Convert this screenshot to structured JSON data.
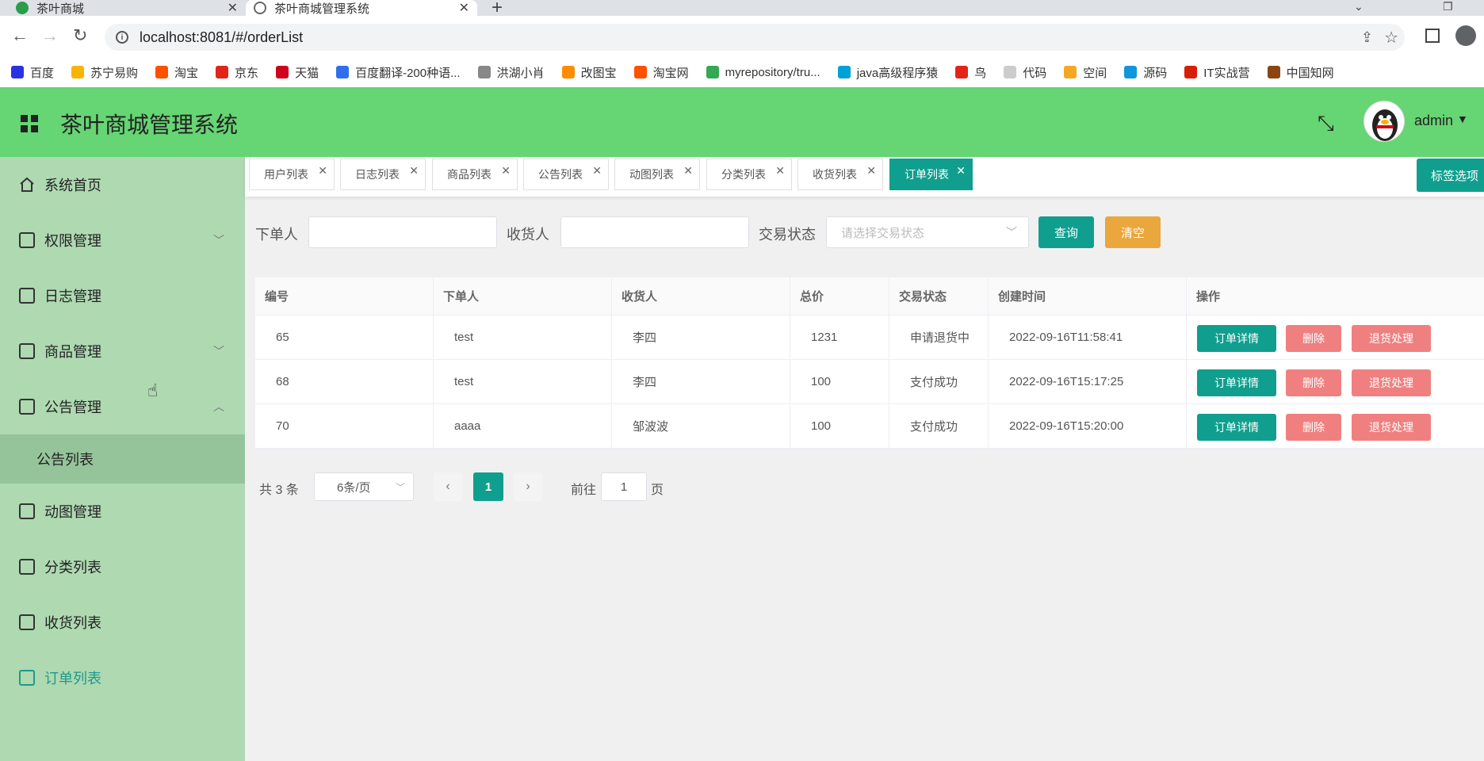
{
  "browser": {
    "tabs": [
      {
        "title": "茶叶商城",
        "favicon_color": "#2a9d4a"
      },
      {
        "title": "茶叶商城管理系统",
        "favicon_color": "#888888"
      }
    ],
    "url": "localhost:8081/#/orderList",
    "bookmarks": [
      {
        "label": "百度",
        "color": "#2932e1"
      },
      {
        "label": "苏宁易购",
        "color": "#f7b500"
      },
      {
        "label": "淘宝",
        "color": "#ff5000"
      },
      {
        "label": "京东",
        "color": "#e1251b"
      },
      {
        "label": "天猫",
        "color": "#d0021b"
      },
      {
        "label": "百度翻译-200种语...",
        "color": "#2f6fec"
      },
      {
        "label": "洪湖小肖",
        "color": "#888888"
      },
      {
        "label": "改图宝",
        "color": "#ff8c00"
      },
      {
        "label": "淘宝网",
        "color": "#ff5000"
      },
      {
        "label": "myrepository/tru...",
        "color": "#34a853"
      },
      {
        "label": "java高级程序猿",
        "color": "#00a1d6"
      },
      {
        "label": "鸟",
        "color": "#e2231a"
      },
      {
        "label": "代码",
        "color": "#cccccc"
      },
      {
        "label": "空间",
        "color": "#f5a623"
      },
      {
        "label": "源码",
        "color": "#1296db"
      },
      {
        "label": "IT实战营",
        "color": "#d81e06"
      },
      {
        "label": "中国知网",
        "color": "#8b4513"
      }
    ]
  },
  "header": {
    "title": "茶叶商城管理系统",
    "username": "admin",
    "bg_color": "#66d573"
  },
  "sidebar": {
    "items": [
      {
        "label": "系统首页",
        "icon": "home-icon",
        "chevron": ""
      },
      {
        "label": "权限管理",
        "icon": "doc-icon",
        "chevron": "﹀"
      },
      {
        "label": "日志管理",
        "icon": "calendar-icon",
        "chevron": ""
      },
      {
        "label": "商品管理",
        "icon": "doc-icon",
        "chevron": "﹀"
      },
      {
        "label": "公告管理",
        "icon": "doc-icon",
        "chevron": "︿"
      },
      {
        "label": "动图管理",
        "icon": "doc-icon",
        "chevron": ""
      },
      {
        "label": "分类列表",
        "icon": "doc-icon",
        "chevron": ""
      },
      {
        "label": "收货列表",
        "icon": "calendar-icon",
        "chevron": ""
      },
      {
        "label": "订单列表",
        "icon": "calendar-icon",
        "chevron": ""
      }
    ],
    "submenu_label": "公告列表",
    "active_item": "订单列表"
  },
  "tags": {
    "items": [
      "用户列表",
      "日志列表",
      "商品列表",
      "公告列表",
      "动图列表",
      "分类列表",
      "收货列表",
      "订单列表"
    ],
    "active": "订单列表",
    "options_label": "标签选项"
  },
  "search": {
    "orderer_label": "下单人",
    "orderer_value": "",
    "receiver_label": "收货人",
    "receiver_value": "",
    "status_label": "交易状态",
    "status_placeholder": "请选择交易状态",
    "query_label": "查询",
    "clear_label": "清空"
  },
  "table": {
    "columns": [
      "编号",
      "下单人",
      "收货人",
      "总价",
      "交易状态",
      "创建时间",
      "操作"
    ],
    "rows": [
      {
        "id": "65",
        "orderer": "test",
        "receiver": "李四",
        "total": "1231",
        "status": "申请退货中",
        "created": "2022-09-16T11:58:41"
      },
      {
        "id": "68",
        "orderer": "test",
        "receiver": "李四",
        "total": "100",
        "status": "支付成功",
        "created": "2022-09-16T15:17:25"
      },
      {
        "id": "70",
        "orderer": "aaaa",
        "receiver": "邹波波",
        "total": "100",
        "status": "支付成功",
        "created": "2022-09-16T15:20:00"
      }
    ],
    "actions": {
      "detail": "订单详情",
      "delete": "删除",
      "return": "退货处理"
    }
  },
  "pagination": {
    "total_text": "共 3 条",
    "page_size": "6条/页",
    "current_page": "1",
    "goto_label": "前往",
    "goto_value": "1",
    "page_suffix": "页"
  },
  "colors": {
    "primary": "#109f8e",
    "danger": "#f08080",
    "warning": "#e9a73d",
    "sidebar_bg": "#aed9b1"
  }
}
